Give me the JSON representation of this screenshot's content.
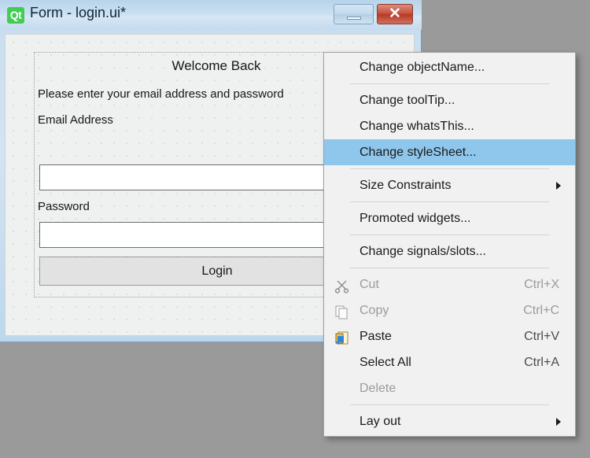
{
  "window": {
    "title": "Form - login.ui*",
    "logo_text": "Qt",
    "minimize_label": "–",
    "close_label": "✕"
  },
  "form": {
    "welcome_title": "Welcome Back",
    "subtitle": "Please enter your email address and password",
    "email_label": "Email Address",
    "email_value": "",
    "email_placeholder": "",
    "password_label": "Password",
    "password_value": "",
    "password_placeholder": "",
    "login_button": "Login"
  },
  "context_menu": {
    "items": [
      {
        "label": "Change objectName...",
        "shortcut": "",
        "icon": "",
        "state": "normal",
        "submenu": false
      },
      {
        "type": "separator"
      },
      {
        "label": "Change toolTip...",
        "shortcut": "",
        "icon": "",
        "state": "normal",
        "submenu": false
      },
      {
        "label": "Change whatsThis...",
        "shortcut": "",
        "icon": "",
        "state": "normal",
        "submenu": false
      },
      {
        "label": "Change styleSheet...",
        "shortcut": "",
        "icon": "",
        "state": "selected",
        "submenu": false
      },
      {
        "type": "separator"
      },
      {
        "label": "Size Constraints",
        "shortcut": "",
        "icon": "",
        "state": "normal",
        "submenu": true
      },
      {
        "type": "separator"
      },
      {
        "label": "Promoted widgets...",
        "shortcut": "",
        "icon": "",
        "state": "normal",
        "submenu": false
      },
      {
        "type": "separator"
      },
      {
        "label": "Change signals/slots...",
        "shortcut": "",
        "icon": "",
        "state": "normal",
        "submenu": false
      },
      {
        "type": "separator"
      },
      {
        "label": "Cut",
        "shortcut": "Ctrl+X",
        "icon": "scissors-icon",
        "state": "disabled",
        "submenu": false
      },
      {
        "label": "Copy",
        "shortcut": "Ctrl+C",
        "icon": "copy-icon",
        "state": "disabled",
        "submenu": false
      },
      {
        "label": "Paste",
        "shortcut": "Ctrl+V",
        "icon": "paste-icon",
        "state": "normal",
        "submenu": false
      },
      {
        "label": "Select All",
        "shortcut": "Ctrl+A",
        "icon": "",
        "state": "normal",
        "submenu": false
      },
      {
        "label": "Delete",
        "shortcut": "",
        "icon": "",
        "state": "disabled",
        "submenu": false
      },
      {
        "type": "separator"
      },
      {
        "label": "Lay out",
        "shortcut": "",
        "icon": "",
        "state": "normal",
        "submenu": true
      }
    ]
  },
  "colors": {
    "desktop_background": "#9a9a9a",
    "menu_background": "#f1f1f1",
    "menu_highlight": "#8fc6ec",
    "qt_green": "#41cd52",
    "close_red": "#c75341",
    "canvas": "#eff0f0"
  }
}
